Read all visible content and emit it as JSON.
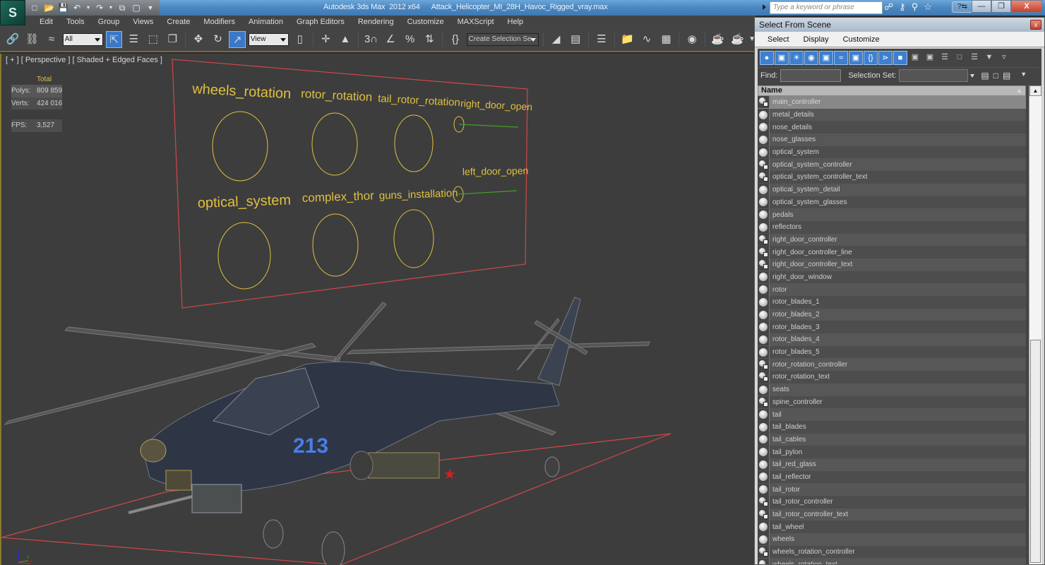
{
  "app": {
    "title_app": "Autodesk 3ds Max  2012 x64",
    "title_file": "Attack_Helicopter_MI_28H_Havoc_Rigged_vray.max",
    "search_placeholder": "Type a keyword or phrase",
    "logo_glyph": "S"
  },
  "quick_access": [
    "new-icon",
    "open-icon",
    "save-icon",
    "undo-icon",
    "redo-icon",
    "project-folder-icon",
    "workspace-icon",
    "customize-dropdown-icon"
  ],
  "menu": [
    "Edit",
    "Tools",
    "Group",
    "Views",
    "Create",
    "Modifiers",
    "Animation",
    "Graph Editors",
    "Rendering",
    "Customize",
    "MAXScript",
    "Help"
  ],
  "toolbar": {
    "selection_filter": "All",
    "reference_coord": "View",
    "named_selection": "Create Selection Se"
  },
  "viewport": {
    "label": "[ + ] [ Perspective ] [ Shaded + Edged Faces ]",
    "stats": {
      "header": "Total",
      "polys_label": "Polys:",
      "polys": "809 859",
      "verts_label": "Verts:",
      "verts": "424 016",
      "fps_label": "FPS:",
      "fps": "3,527"
    },
    "controls_panel": {
      "labels": [
        "wheels_rotation",
        "rotor_rotation",
        "tail_rotor_rotation",
        "right_door_open",
        "optical_system",
        "complex_thor",
        "guns_installation",
        "left_door_open"
      ]
    },
    "helicopter_number": "213",
    "axis": {
      "z": "z",
      "y": "y",
      "x": "x"
    },
    "colors": {
      "text": "#e0c040",
      "frame": "#d04848",
      "slider": "#3fa02a"
    }
  },
  "dialog": {
    "title": "Select From Scene",
    "menu": [
      "Select",
      "Display",
      "Customize"
    ],
    "find_label": "Find:",
    "find_value": "",
    "selection_set_label": "Selection Set:",
    "selection_set_value": "",
    "column_name": "Name",
    "items": [
      {
        "name": "main_controller",
        "type": "helper",
        "selected": true
      },
      {
        "name": "metal_details",
        "type": "geometry"
      },
      {
        "name": "nose_details",
        "type": "geometry"
      },
      {
        "name": "nose_glasses",
        "type": "geometry"
      },
      {
        "name": "optical_system",
        "type": "geometry"
      },
      {
        "name": "optical_system_controller",
        "type": "helper"
      },
      {
        "name": "optical_system_controller_text",
        "type": "helper"
      },
      {
        "name": "optical_system_detail",
        "type": "geometry"
      },
      {
        "name": "optical_system_glasses",
        "type": "geometry"
      },
      {
        "name": "pedals",
        "type": "geometry"
      },
      {
        "name": "reflectors",
        "type": "geometry"
      },
      {
        "name": "right_door_controller",
        "type": "helper"
      },
      {
        "name": "right_door_controller_line",
        "type": "helper"
      },
      {
        "name": "right_door_controller_text",
        "type": "helper"
      },
      {
        "name": "right_door_window",
        "type": "geometry"
      },
      {
        "name": "rotor",
        "type": "geometry"
      },
      {
        "name": "rotor_blades_1",
        "type": "geometry"
      },
      {
        "name": "rotor_blades_2",
        "type": "geometry"
      },
      {
        "name": "rotor_blades_3",
        "type": "geometry"
      },
      {
        "name": "rotor_blades_4",
        "type": "geometry"
      },
      {
        "name": "rotor_blades_5",
        "type": "geometry"
      },
      {
        "name": "rotor_rotation_controller",
        "type": "helper"
      },
      {
        "name": "rotor_rotation_text",
        "type": "helper"
      },
      {
        "name": "seats",
        "type": "geometry"
      },
      {
        "name": "spine_controller",
        "type": "helper"
      },
      {
        "name": "tail",
        "type": "geometry"
      },
      {
        "name": "tail_blades",
        "type": "geometry"
      },
      {
        "name": "tail_cables",
        "type": "geometry"
      },
      {
        "name": "tail_pylon",
        "type": "geometry"
      },
      {
        "name": "tail_red_glass",
        "type": "geometry"
      },
      {
        "name": "tail_reflector",
        "type": "geometry"
      },
      {
        "name": "tail_rotor",
        "type": "geometry"
      },
      {
        "name": "tail_rotor_controller",
        "type": "helper"
      },
      {
        "name": "tail_rotor_controller_text",
        "type": "helper"
      },
      {
        "name": "tail_wheel",
        "type": "geometry"
      },
      {
        "name": "wheels",
        "type": "geometry"
      },
      {
        "name": "wheels_rotation_controller",
        "type": "helper"
      },
      {
        "name": "wheels_rotation_text",
        "type": "helper"
      }
    ],
    "scroll_position": 1.0
  }
}
